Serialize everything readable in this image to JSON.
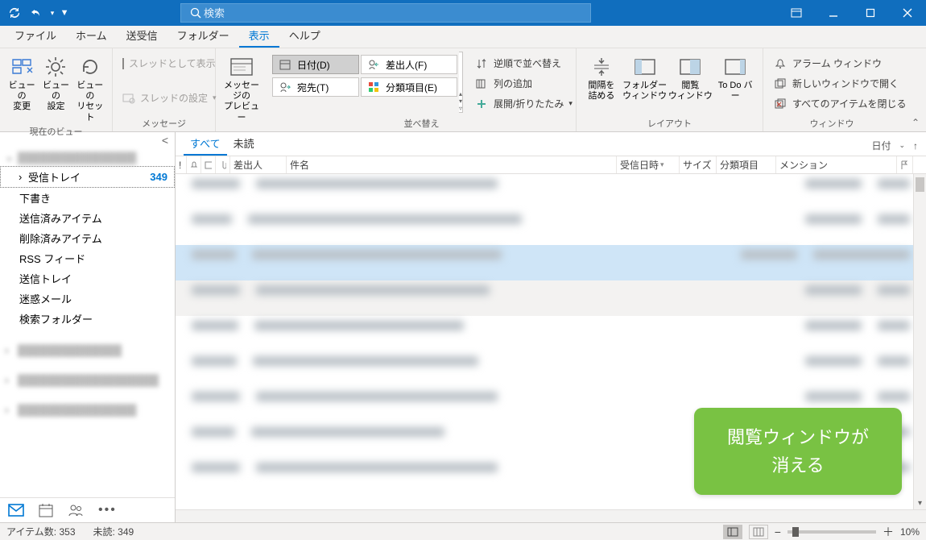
{
  "search": {
    "placeholder": "検索"
  },
  "menus": {
    "file": "ファイル",
    "home": "ホーム",
    "sendrecv": "送受信",
    "folder": "フォルダー",
    "view": "表示",
    "help": "ヘルプ"
  },
  "ribbon": {
    "view_group": "現在のビュー",
    "view_btn1": "ビューの\n変更",
    "view_btn2": "ビューの\n設定",
    "view_btn3": "ビューの\nリセット",
    "msg_group": "メッセージ",
    "msg_thread": "スレッドとして表示",
    "msg_thread_settings": "スレッドの設定",
    "preview_btn": "メッセージの\nプレビュー",
    "sort_group": "並べ替え",
    "sort_date": "日付(D)",
    "sort_from": "差出人(F)",
    "sort_to": "宛先(T)",
    "sort_cat": "分類項目(E)",
    "sort_reverse": "逆順で並べ替え",
    "sort_addcol": "列の追加",
    "sort_expand": "展開/折りたたみ",
    "layout_group": "レイアウト",
    "layout_spacing": "間隔を\n詰める",
    "layout_folderpane": "フォルダー\nウィンドウ",
    "layout_reading": "閲覧\nウィンドウ",
    "layout_todo": "To Do バ\nー",
    "window_group": "ウィンドウ",
    "window_alarm": "アラーム ウィンドウ",
    "window_newwin": "新しいウィンドウで開く",
    "window_closeall": "すべてのアイテムを閉じる"
  },
  "nav": {
    "inbox": "受信トレイ",
    "inbox_count": "349",
    "drafts": "下書き",
    "sent": "送信済みアイテム",
    "deleted": "削除済みアイテム",
    "rss": "RSS フィード",
    "outbox": "送信トレイ",
    "junk": "迷惑メール",
    "search": "検索フォルダー"
  },
  "filter": {
    "all": "すべて",
    "unread": "未読",
    "sort_label": "日付"
  },
  "cols": {
    "from": "差出人",
    "subject": "件名",
    "received": "受信日時",
    "size": "サイズ",
    "cat": "分類項目",
    "mention": "メンション"
  },
  "callout": "閲覧ウィンドウが\n消える",
  "status": {
    "items": "アイテム数: 353",
    "unread": "未読: 349",
    "zoom": "10%"
  }
}
